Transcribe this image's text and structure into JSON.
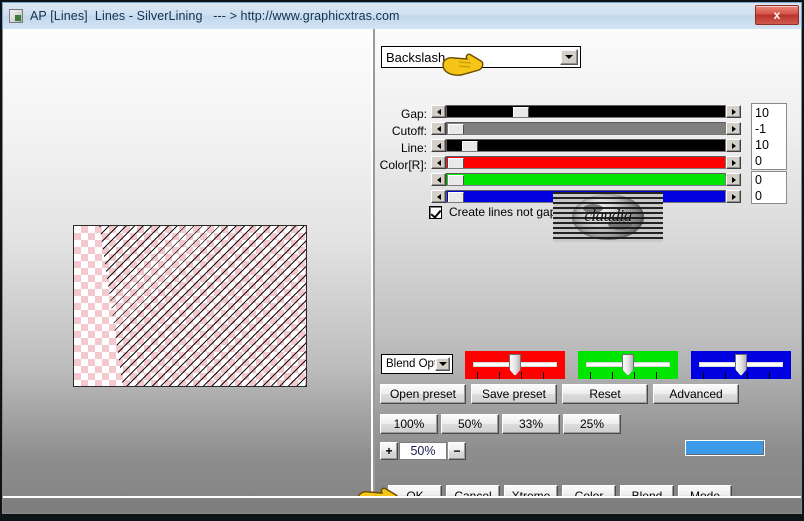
{
  "window": {
    "title": "AP [Lines]  Lines - SilverLining   --- > http://www.graphicxtras.com",
    "icon": "app-icon",
    "close_label": "x"
  },
  "preset_combo": {
    "value": "Backslash",
    "arrow": "chevron-down-icon"
  },
  "sliders": [
    {
      "label": "Gap:",
      "value": "10",
      "thumb_pct": 31,
      "fill": "black"
    },
    {
      "label": "Cutoff:",
      "value": "-1",
      "thumb_pct": 1,
      "fill": "gray"
    },
    {
      "label": "Line:",
      "value": "10",
      "thumb_pct": 8,
      "fill": "blackline"
    },
    {
      "label": "Color[R]:",
      "value": "0",
      "thumb_pct": 1,
      "fill": "#ff0000"
    },
    {
      "label": "",
      "value": "0",
      "thumb_pct": 1,
      "fill": "#00e500"
    },
    {
      "label": "",
      "value": "0",
      "thumb_pct": 1,
      "fill": "#0000e0"
    }
  ],
  "checkbox": {
    "label": "Create lines not gaps",
    "checked": true
  },
  "logo": {
    "word": "claudia"
  },
  "blend_combo": {
    "value": "Blend Opti"
  },
  "rgb_sliders": [
    {
      "name": "red-channel",
      "color": "#ff0000",
      "knob_pct": 50
    },
    {
      "name": "green-channel",
      "color": "#00e500",
      "knob_pct": 50
    },
    {
      "name": "blue-channel",
      "color": "#0000e0",
      "knob_pct": 50
    }
  ],
  "preset_buttons": [
    {
      "label": "Open preset"
    },
    {
      "label": "Save preset"
    },
    {
      "label": "Reset"
    },
    {
      "label": "Advanced"
    }
  ],
  "zoom_buttons": [
    {
      "label": "100%"
    },
    {
      "label": "50%"
    },
    {
      "label": "33%"
    },
    {
      "label": "25%"
    }
  ],
  "zoom_stepper": {
    "increase": "+",
    "value": "50%",
    "decrease": "−"
  },
  "color_swatch": {
    "color": "#3d9ae8"
  },
  "action_buttons": [
    {
      "label": "OK"
    },
    {
      "label": "Cancel"
    },
    {
      "label": "Xtreme"
    },
    {
      "label": "Color"
    },
    {
      "label": "Blend"
    },
    {
      "label": "Mode"
    }
  ]
}
